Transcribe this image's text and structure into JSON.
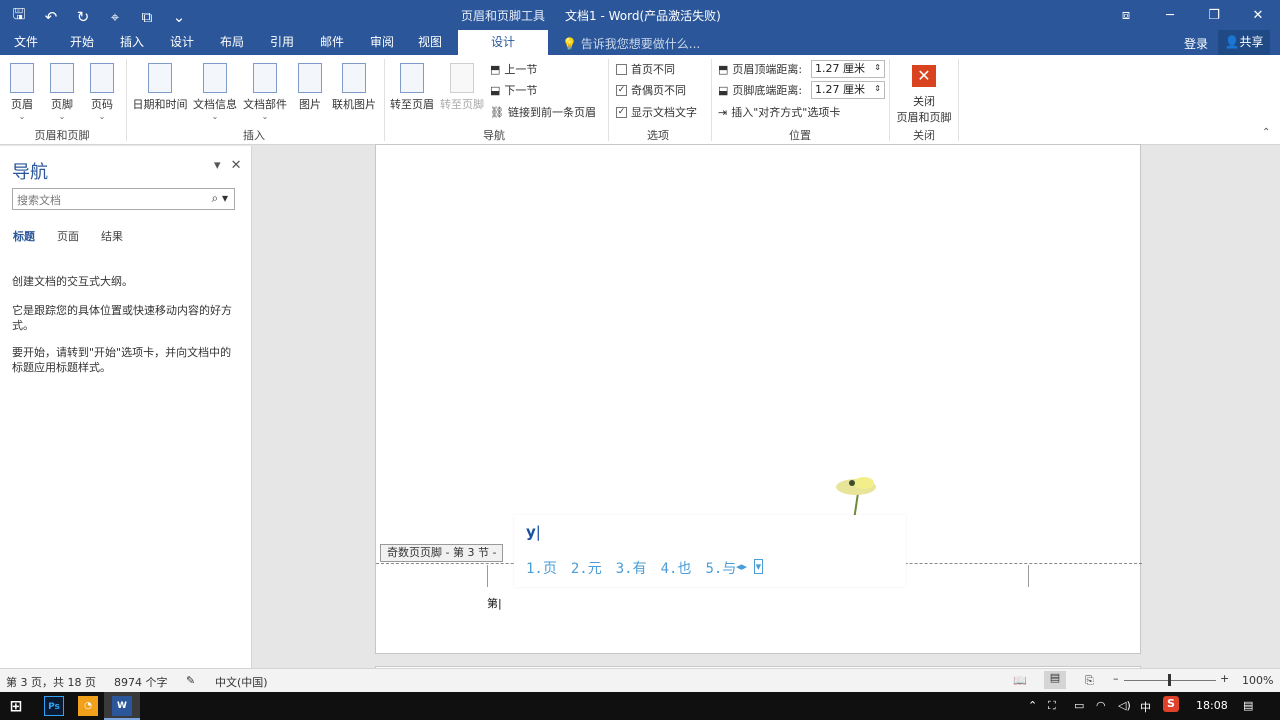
{
  "titlebar": {
    "context_tab_group": "页眉和页脚工具",
    "document_title": "文档1 - Word(产品激活失败)",
    "qat_icons": [
      "save-icon",
      "undo-icon",
      "redo-icon",
      "touch-mode-icon",
      "customize-icon"
    ]
  },
  "tabs": {
    "items": [
      "文件",
      "开始",
      "插入",
      "设计",
      "布局",
      "引用",
      "邮件",
      "审阅",
      "视图",
      "设计"
    ],
    "active_index": 9,
    "tell_me": "告诉我您想要做什么...",
    "login": "登录",
    "share": "共享"
  },
  "ribbon": {
    "header_footer": {
      "label": "页眉和页脚",
      "buttons": [
        "页眉",
        "页脚",
        "页码"
      ]
    },
    "insert": {
      "label": "插入",
      "buttons": [
        "日期和时间",
        "文档信息",
        "文档部件",
        "图片",
        "联机图片"
      ]
    },
    "navigation": {
      "label": "导航",
      "goto_header": "转至页眉",
      "goto_footer": "转至页脚",
      "prev_section": "上一节",
      "next_section": "下一节",
      "link_previous": "链接到前一条页眉"
    },
    "options": {
      "label": "选项",
      "different_first": "首页不同",
      "different_odd_even": "奇偶页不同",
      "show_doc_text": "显示文档文字",
      "different_first_checked": false,
      "different_odd_even_checked": true,
      "show_doc_text_checked": true
    },
    "position": {
      "label": "位置",
      "header_top_label": "页眉顶端距离:",
      "header_top_value": "1.27 厘米",
      "footer_bottom_label": "页脚底端距离:",
      "footer_bottom_value": "1.27 厘米",
      "insert_align_tab": "插入\"对齐方式\"选项卡"
    },
    "close": {
      "label": "关闭",
      "button_line1": "关闭",
      "button_line2": "页眉和页脚"
    }
  },
  "navpane": {
    "title": "导航",
    "search_placeholder": "搜索文档",
    "tabs": [
      "标题",
      "页面",
      "结果"
    ],
    "para1": "创建文档的交互式大纲。",
    "para2": "它是跟踪您的具体位置或快速移动内容的好方式。",
    "para3": "要开始，请转到\"开始\"选项卡，并向文档中的标题应用标题样式。"
  },
  "document": {
    "footer_tag": "奇数页页脚 - 第 3 节 -",
    "footer_text": "第",
    "ime_input": "y",
    "ime_candidates": [
      "1.页",
      "2.元",
      "3.有",
      "4.也",
      "5.与"
    ]
  },
  "statusbar": {
    "page_info": "第 3 页，共 18 页",
    "word_count": "8974 个字",
    "language": "中文(中国)",
    "zoom": "100%"
  },
  "taskbar": {
    "ime_indicator": "中",
    "time": "18:08"
  },
  "colors": {
    "brand": "#2b579a",
    "close_button": "#d9431f",
    "ime_candidate": "#4b9dd6"
  }
}
